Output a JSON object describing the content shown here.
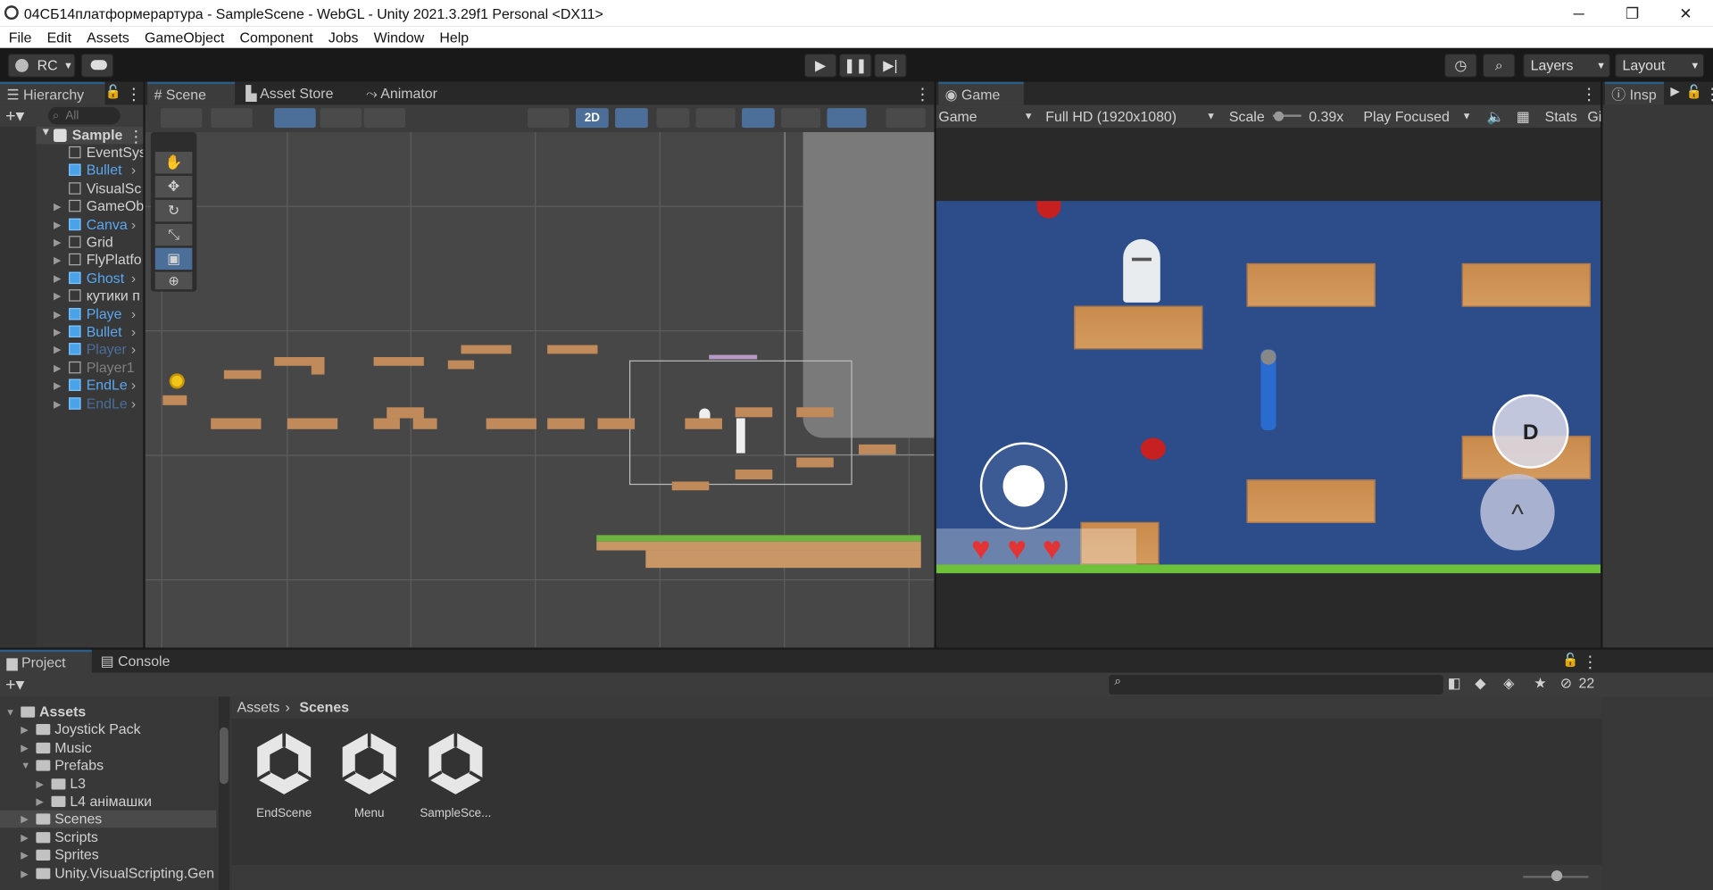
{
  "window": {
    "title": "04СБ14платформерартура - SampleScene - WebGL - Unity 2021.3.29f1 Personal <DX11>",
    "minimize": "─",
    "maximize": "❐",
    "close": "✕"
  },
  "menu": [
    "File",
    "Edit",
    "Assets",
    "GameObject",
    "Component",
    "Jobs",
    "Window",
    "Help"
  ],
  "toolbar": {
    "account": "RC",
    "layers": "Layers",
    "layout": "Layout"
  },
  "hierarchy": {
    "tab": "Hierarchy",
    "search_placeholder": "All",
    "scene": "Sample",
    "items": [
      {
        "label": "EventSys",
        "color": "#d2d2d2"
      },
      {
        "label": "Bullet",
        "color": "#5aa8f0"
      },
      {
        "label": "VisualSc",
        "color": "#d2d2d2"
      },
      {
        "label": "GameOb",
        "color": "#d2d2d2"
      },
      {
        "label": "Canva",
        "color": "#5aa8f0"
      },
      {
        "label": "Grid",
        "color": "#d2d2d2"
      },
      {
        "label": "FlyPlatfo",
        "color": "#d2d2d2"
      },
      {
        "label": "Ghost",
        "color": "#5aa8f0"
      },
      {
        "label": "кутики п",
        "color": "#d2d2d2"
      },
      {
        "label": "Playe",
        "color": "#5aa8f0"
      },
      {
        "label": "Bullet",
        "color": "#5aa8f0"
      },
      {
        "label": "Player",
        "color": "#4a6e9a"
      },
      {
        "label": "Player1",
        "color": "#808080"
      },
      {
        "label": "EndLe",
        "color": "#5aa8f0"
      },
      {
        "label": "EndLe",
        "color": "#4a6e9a"
      }
    ]
  },
  "scene": {
    "tabs": [
      "Scene",
      "Asset Store",
      "Animator"
    ],
    "mode_2d": "2D"
  },
  "game": {
    "tab": "Game",
    "display": "Game",
    "resolution": "Full HD (1920x1080)",
    "scale_label": "Scale",
    "scale_value": "0.39x",
    "play_mode": "Play Focused",
    "stats": "Stats",
    "gizmos": "Gi",
    "btn_d": "D",
    "btn_up": "^"
  },
  "inspector": {
    "tab": "Insp"
  },
  "project": {
    "tabs": [
      "Project",
      "Console"
    ],
    "tree": [
      {
        "label": "Assets",
        "level": 0,
        "bold": true
      },
      {
        "label": "Joystick Pack",
        "level": 1
      },
      {
        "label": "Music",
        "level": 1
      },
      {
        "label": "Prefabs",
        "level": 1
      },
      {
        "label": "L3",
        "level": 2
      },
      {
        "label": "L4 анімашки",
        "level": 2
      },
      {
        "label": "Scenes",
        "level": 1,
        "selected": true
      },
      {
        "label": "Scripts",
        "level": 1
      },
      {
        "label": "Sprites",
        "level": 1
      },
      {
        "label": "Unity.VisualScripting.Gen",
        "level": 1
      }
    ],
    "breadcrumb": [
      "Assets",
      "Scenes"
    ],
    "assets": [
      "EndScene",
      "Menu",
      "SampleSce..."
    ],
    "hidden_count": "22"
  }
}
